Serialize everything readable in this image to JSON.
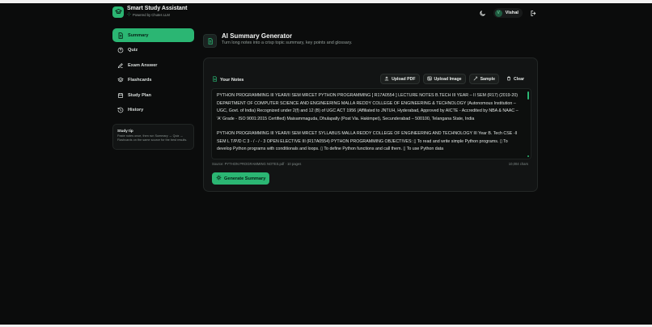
{
  "app": {
    "title": "Smart Study Assistant",
    "subtitle": "Powered by Chutes LLM"
  },
  "header": {
    "user_initial": "V",
    "user_name": "Vishal"
  },
  "sidebar": {
    "items": [
      {
        "label": "Summary",
        "icon": "document-icon",
        "active": true
      },
      {
        "label": "Quiz",
        "icon": "help-circle-icon",
        "active": false
      },
      {
        "label": "Exam Answer",
        "icon": "pen-icon",
        "active": false
      },
      {
        "label": "Flashcards",
        "icon": "layers-icon",
        "active": false
      },
      {
        "label": "Study Plan",
        "icon": "calendar-icon",
        "active": false
      },
      {
        "label": "History",
        "icon": "history-icon",
        "active": false
      }
    ],
    "tip": {
      "title": "Study tip",
      "body": "Paste notes once, then run Summary → Quiz → Flashcards on the same source for the best results."
    }
  },
  "main": {
    "title": "AI Summary Generator",
    "subtitle": "Turn long notes into a crisp topic summary, key points and glossary.",
    "notes_label": "Your Notes",
    "buttons": {
      "upload_pdf": "Upload PDF",
      "upload_image": "Upload Image",
      "sample": "Sample",
      "clear": "Clear"
    },
    "notes_paragraph_1": "PYTHON PROGRAMMING   III YEAR/II SEM   MRCET PYTHON PROGRAMMING [ R17A0554 ] LECTURE NOTES B.TECH III YEAR – II SEM (R17) (2019-20) DEPARTMENT OF COMPUTER SCIENCE AND ENGINEERING MALLA REDDY COLLEGE OF ENGINEERING & TECHNOLOGY (Autonomous Institution – UGC, Govt. of India) Recognized under 2(f) and 12 (B) of UGC ACT 1956 (Affiliated to JNTUH, Hyderabad, Approved by AICTE - Accredited by NBA & NAAC – 'A' Grade - ISO 9001:2015 Certified) Maisammaguda, Dhulapally (Post Via. Hakimpet), Secunderabad – 500100, Telangana State, India",
    "notes_paragraph_2": "PYTHON PROGRAMMING   III YEAR/II SEM   MRCET SYLLABUS MALLA REDDY COLLEGE OF ENGINEERING AND TECHNOLOGY III Year B. Tech CSE -II SEM   L   T/P/D C 3   - / - / - 3 OPEN ELECTIVE III (R17A0554) PYTHON PROGRAMMING OBJECTIVES: ▯   To read and write simple Python programs. ▯   To develop Python programs with conditionals and loops. ▯   To define Python functions and call them. ▯   To use Python data",
    "source": "Source: PYTHON PROGRAMMING NOTES.pdf · 10 pages",
    "char_count": "10,004 chars",
    "generate_label": "Generate Summary"
  },
  "colors": {
    "accent": "#2bb673",
    "background": "#0b0c0c",
    "card": "#121414"
  }
}
